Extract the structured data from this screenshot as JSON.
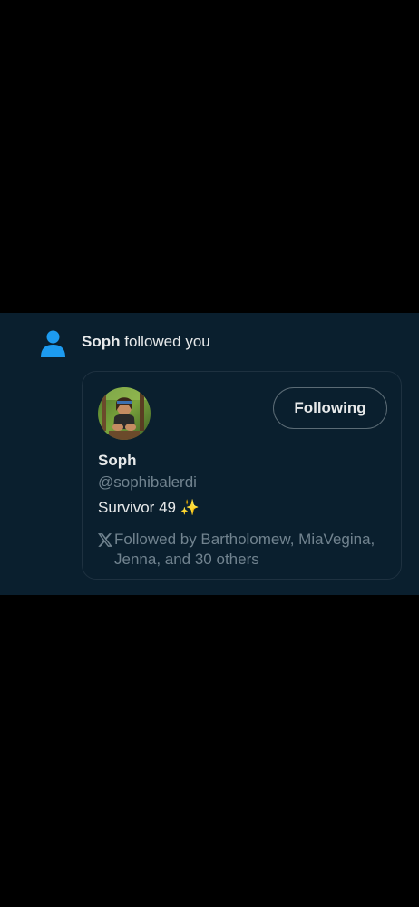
{
  "notification": {
    "actor_name": "Soph",
    "action_text": " followed you",
    "icon": "person-icon",
    "accent_color": "#1d9bf0"
  },
  "card": {
    "follow_button_label": "Following",
    "display_name": "Soph",
    "handle": "@sophibalerdi",
    "bio_text": "Survivor 49",
    "bio_emoji": "✨",
    "followed_by_icon": "x-logo-icon",
    "followed_by_text": "Followed by Bartholomew, MiaVegina, Jenna, and 30 others"
  }
}
